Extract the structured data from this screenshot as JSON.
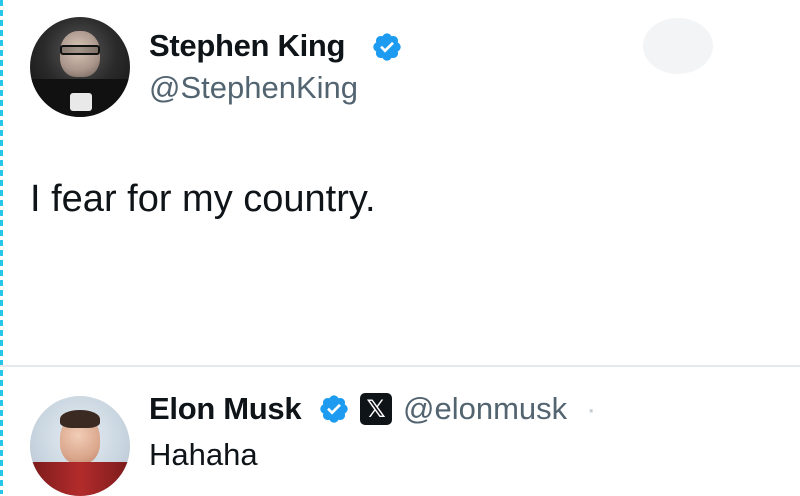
{
  "tweet": {
    "author_name": "Stephen King",
    "author_handle": "@StephenKing",
    "text": "I fear for my country."
  },
  "reply": {
    "author_name": "Elon Musk",
    "author_handle": "@elonmusk",
    "separator": "·",
    "text": "Hahaha",
    "x_badge_glyph": "𝕏"
  },
  "colors": {
    "verified_blue": "#1d9bf0",
    "text_primary": "#0f1419",
    "text_secondary": "#536471",
    "divider": "#e6e9ec"
  }
}
